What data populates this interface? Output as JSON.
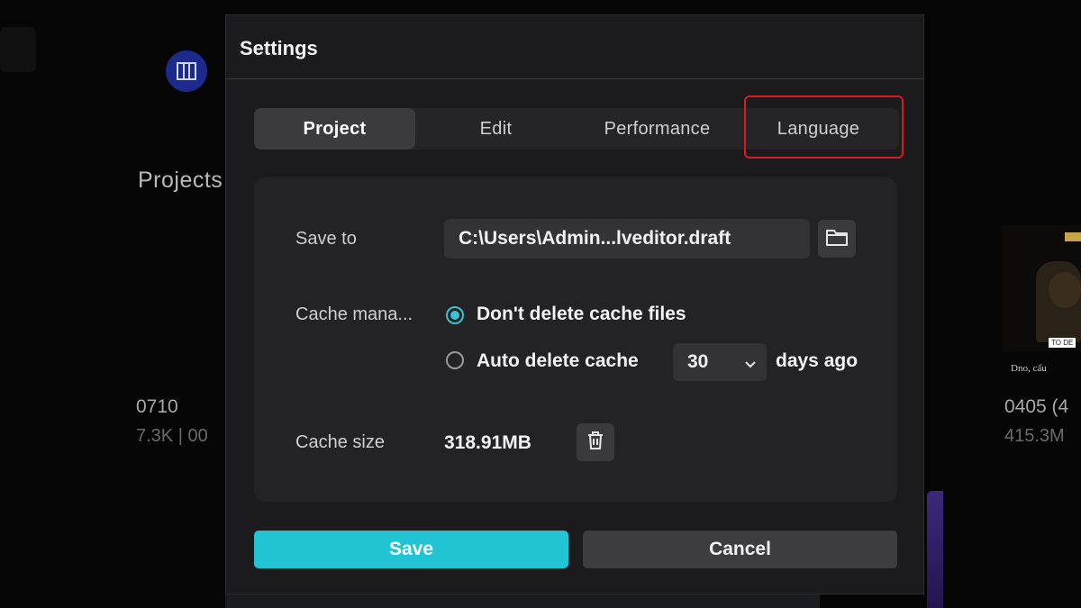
{
  "background": {
    "section_title": "Projects",
    "project_left": {
      "name": "0710",
      "meta": "7.3K | 00"
    },
    "project_right": {
      "name": "0405 (4",
      "meta": "415.3M",
      "thumb_caption": "Dno, cấu"
    }
  },
  "dialog": {
    "title": "Settings",
    "tabs": [
      {
        "label": "Project",
        "active": true
      },
      {
        "label": "Edit",
        "active": false
      },
      {
        "label": "Performance",
        "active": false
      },
      {
        "label": "Language",
        "active": false,
        "highlighted": true
      }
    ],
    "save_to": {
      "label": "Save to",
      "path": "C:\\Users\\Admin...lveditor.draft",
      "icon": "folder-icon"
    },
    "cache_management": {
      "label": "Cache mana...",
      "options": [
        {
          "label": "Don't delete cache files",
          "selected": true
        },
        {
          "label": "Auto delete cache",
          "selected": false
        }
      ],
      "days_value": "30",
      "days_suffix": "days ago"
    },
    "cache_size": {
      "label": "Cache size",
      "value": "318.91MB",
      "icon": "trash-icon"
    },
    "buttons": {
      "save": "Save",
      "cancel": "Cancel"
    }
  },
  "colors": {
    "accent": "#20c4d3",
    "highlight": "#e0191b",
    "dialog_bg": "#1b1b1d"
  }
}
